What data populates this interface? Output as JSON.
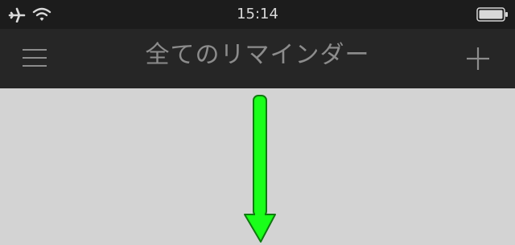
{
  "status_bar": {
    "time": "15:14",
    "icons": [
      "airplane-icon",
      "wifi-icon",
      "battery-icon"
    ]
  },
  "nav_bar": {
    "title": "全てのリマインダー",
    "left_icon": "menu-icon",
    "right_icon": "plus-icon"
  },
  "content": {
    "gesture_hint": "arrow-down-icon"
  },
  "colors": {
    "status_bar_bg": "#1c1c1c",
    "nav_bar_bg": "#262626",
    "nav_title": "#8c8c8c",
    "content_bg": "#d3d3d3",
    "arrow": "#1aff1a"
  }
}
